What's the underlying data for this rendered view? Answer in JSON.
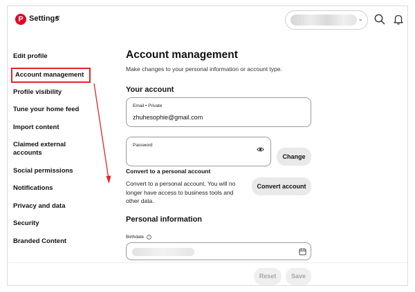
{
  "header": {
    "app_title": "Settings",
    "menu_icon": "hamburger-icon",
    "logo_icon": "pinterest-logo-icon",
    "search_icon": "search-icon",
    "notifications_icon": "bell-icon",
    "account_chevron": "⌄",
    "brand_color": "#e60023"
  },
  "sidebar": {
    "items": [
      {
        "label": "Edit profile"
      },
      {
        "label": "Account management",
        "active": true
      },
      {
        "label": "Profile visibility"
      },
      {
        "label": "Tune your home feed"
      },
      {
        "label": "Import content"
      },
      {
        "label": "Claimed external accounts"
      },
      {
        "label": "Social permissions"
      },
      {
        "label": "Notifications"
      },
      {
        "label": "Privacy and data"
      },
      {
        "label": "Security"
      },
      {
        "label": "Branded Content"
      }
    ],
    "highlight_color": "#e0242c"
  },
  "main": {
    "title": "Account management",
    "subtitle": "Make changes to your personal information or account type.",
    "your_account": {
      "heading": "Your account",
      "email_label": "Email • Private",
      "email_value": "zhuhesophie@gmail.com",
      "password_label": "Password",
      "change_button": "Change"
    },
    "convert": {
      "heading": "Convert to a personal account",
      "description": "Convert to a personal account. You will no longer have access to business tools and other data.",
      "button": "Convert account"
    },
    "personal_info": {
      "heading": "Personal information",
      "birthdate_label": "Birthdate"
    }
  },
  "footer": {
    "reset_button": "Reset",
    "save_button": "Save"
  }
}
